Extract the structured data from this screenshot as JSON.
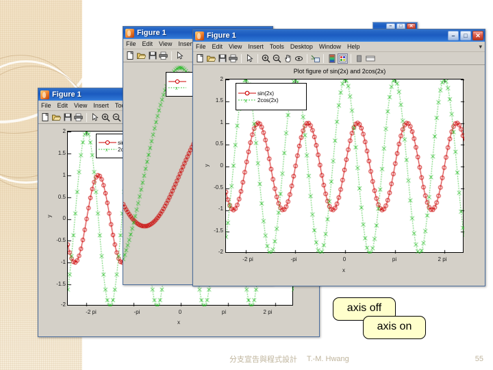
{
  "slide": {
    "footer_text": "分支宣告與程式設計",
    "footer_author": "T.-M. Hwang",
    "page_number": "55"
  },
  "callouts": {
    "axis_off": "axis off",
    "axis_on": "axis on"
  },
  "windows": {
    "main": {
      "title": "Figure 1",
      "menus": [
        "File",
        "Edit",
        "View",
        "Insert",
        "Tools",
        "Desktop",
        "Window",
        "Help"
      ],
      "menu_overflow": "▾",
      "buttons": {
        "minimize": "–",
        "maximize": "□",
        "close": "✕"
      },
      "toolbar_icons": [
        "new-figure-icon",
        "open-file-icon",
        "save-figure-icon",
        "print-figure-icon",
        "pointer-icon",
        "zoom-in-icon",
        "zoom-out-icon",
        "pan-icon",
        "rotate-3d-icon",
        "data-cursor-icon",
        "colorbar-icon",
        "legend-icon",
        "hide-plot-tools-icon",
        "show-plot-tools-icon"
      ]
    },
    "middle": {
      "title": "Figure 1",
      "menus": [
        "File",
        "Edit",
        "View",
        "Insert"
      ],
      "toolbar_icons": [
        "new-figure-icon",
        "open-file-icon",
        "save-figure-icon",
        "print-figure-icon",
        "pointer-icon"
      ]
    },
    "lower_left": {
      "title": "Figure 1",
      "menus": [
        "File",
        "Edit",
        "View",
        "Insert",
        "Tools"
      ],
      "toolbar_icons": [
        "new-figure-icon",
        "open-file-icon",
        "save-figure-icon",
        "print-figure-icon",
        "pointer-icon",
        "zoom-in-icon",
        "zoom-out-icon"
      ]
    },
    "behind": {
      "buttons": {
        "minimize": "–",
        "maximize": "□",
        "close": "✕"
      }
    }
  },
  "chart_data": {
    "type": "line",
    "title": "Plot figure of sin(2x) and 2cos(2x)",
    "xlabel": "x",
    "ylabel": "y",
    "xlim": [
      -7.5398,
      7.5398
    ],
    "ylim": [
      -2,
      2
    ],
    "grid": false,
    "legend_position": "upper-left",
    "xticks": [
      -6.2832,
      -3.1416,
      0,
      3.1416,
      6.2832
    ],
    "xticklabels": [
      "-2 pi",
      "-pi",
      "0",
      "pi",
      "2 pi"
    ],
    "yticks": [
      -2,
      -1.5,
      -1,
      -0.5,
      0,
      0.5,
      1,
      1.5,
      2
    ],
    "yticklabels": [
      "-2",
      "-1.5",
      "-1",
      "-0.5",
      "0",
      "0.5",
      "1",
      "1.5",
      "2"
    ],
    "series": [
      {
        "name": "sin(2x)",
        "color": "#cc0000",
        "linestyle": "-",
        "marker": "o",
        "amplitude": 1,
        "frequency": 2,
        "phase": 0,
        "function": "sin(2x)"
      },
      {
        "name": "2cos(2x)",
        "color": "#22bb22",
        "linestyle": ":",
        "marker": "x",
        "amplitude": 2,
        "frequency": 2,
        "phase": 1.5708,
        "function": "2cos(2x)"
      }
    ]
  }
}
